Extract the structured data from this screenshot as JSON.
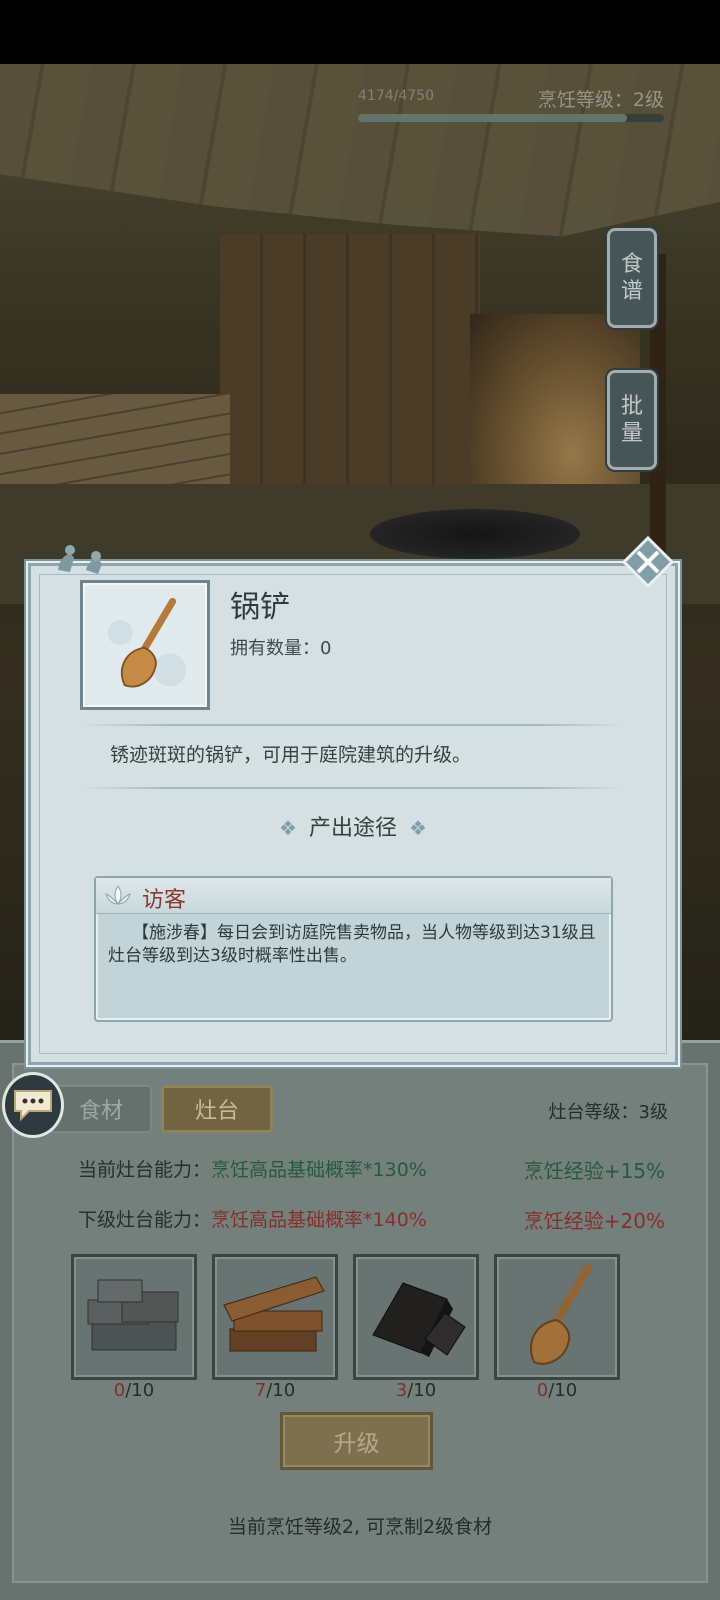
{
  "header": {
    "exp_text": "4174/4750",
    "exp_progress": 0.8787,
    "cooking_level": "烹饪等级：2级"
  },
  "side_buttons": [
    {
      "label": "食\n谱"
    },
    {
      "label": "批\n量"
    }
  ],
  "modal": {
    "item_name": "锅铲",
    "owned": "拥有数量：0",
    "description": "锈迹斑斑的锅铲，可用于庭院建筑的升级。",
    "source_title": "产出途径",
    "source": {
      "title": "访客",
      "text": "【施涉春】每日会到访庭院售卖物品，当人物等级到达31级且灶台等级到达3级时概率性出售。"
    }
  },
  "tabs": [
    {
      "label": "食材"
    },
    {
      "label": "灶台"
    }
  ],
  "stove": {
    "level": "灶台等级：3级",
    "current_label": "当前灶台能力：",
    "current_value": "烹饪高品基础概率*130%",
    "current_exp": "烹饪经验+15%",
    "next_label": "下级灶台能力：",
    "next_value": "烹饪高品基础概率*140%",
    "next_exp": "烹饪经验+20%"
  },
  "materials": [
    {
      "icon": "stone-bricks-icon",
      "have": "0",
      "need": "/10"
    },
    {
      "icon": "wood-planks-icon",
      "have": "7",
      "need": "/10"
    },
    {
      "icon": "iron-ingot-icon",
      "have": "3",
      "need": "/10"
    },
    {
      "icon": "spatula-icon",
      "have": "0",
      "need": "/10"
    }
  ],
  "upgrade_label": "升级",
  "bottom_note": "当前烹饪等级2, 可烹制2级食材",
  "colors": {
    "modal_bg": "#d4e0e2",
    "green_text": "#2f6e4e",
    "red_text": "#a33a33",
    "visitor_title": "#8a3a2c"
  }
}
